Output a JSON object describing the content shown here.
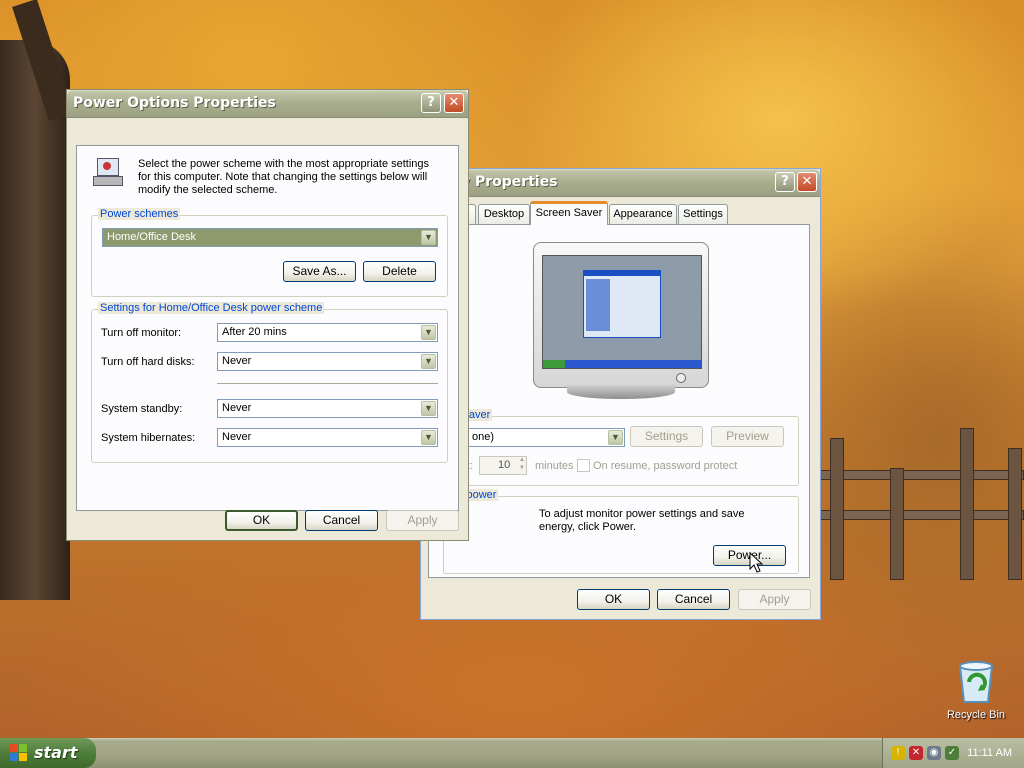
{
  "power_window": {
    "title": "Power Options Properties",
    "intro": "Select the power scheme with the most appropriate settings for this computer. Note that changing the settings below will modify the selected scheme.",
    "schemes_legend": "Power schemes",
    "scheme_value": "Home/Office Desk",
    "save_as": "Save As...",
    "delete": "Delete",
    "settings_legend": "Settings for Home/Office Desk power scheme",
    "rows": [
      {
        "label": "Turn off monitor:",
        "value": "After 20 mins"
      },
      {
        "label": "Turn off hard disks:",
        "value": "Never"
      },
      {
        "label": "System standby:",
        "value": "Never"
      },
      {
        "label": "System hibernates:",
        "value": "Never"
      }
    ],
    "ok": "OK",
    "cancel": "Cancel",
    "apply": "Apply"
  },
  "display_window": {
    "title": "y Properties",
    "tabs": [
      "s",
      "Desktop",
      "Screen Saver",
      "Appearance",
      "Settings"
    ],
    "active_tab": "Screen Saver",
    "screensaver_legend": "een saver",
    "screensaver_value": "one)",
    "settings_btn": "Settings",
    "preview_btn": "Preview",
    "wait_label": "t:",
    "wait_value": "10",
    "minutes": "minutes",
    "resume_label": "On resume, password protect",
    "monitor_legend": "nitor power",
    "monitor_text": "To adjust monitor power settings and save energy, click Power.",
    "power_btn": "Power...",
    "ok": "OK",
    "cancel": "Cancel",
    "apply": "Apply"
  },
  "desktop": {
    "recycle_bin": "Recycle Bin"
  },
  "taskbar": {
    "start": "start",
    "clock": "11:11 AM"
  },
  "icons": {
    "help": "?",
    "close": "✕",
    "dropdown": "▼",
    "spin_up": "▲",
    "spin_down": "▼"
  },
  "colors": {
    "window_face": "#ece9d8",
    "titlebar": "#a9ad8e",
    "group_legend": "#0046d5",
    "active_tab_accent": "#e68b2c",
    "start_button": "#4f7d3a"
  }
}
